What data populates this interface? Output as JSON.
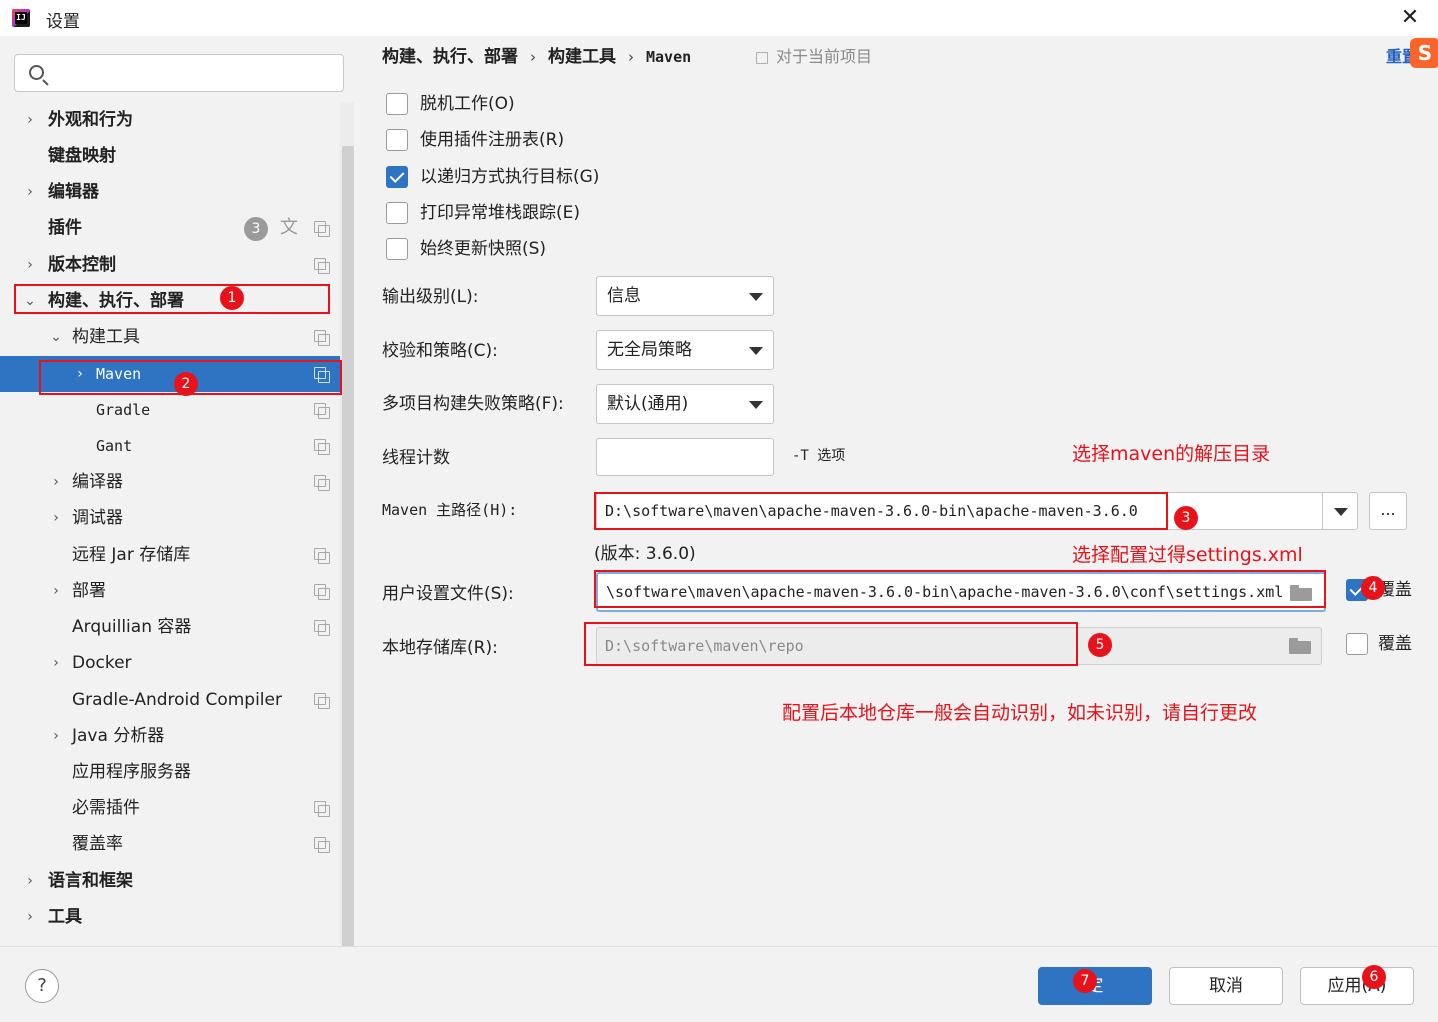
{
  "window": {
    "title": "设置",
    "app_icon": "intellij-idea-icon",
    "close_symbol": "✕"
  },
  "sidebar": {
    "search_placeholder": "",
    "plugins_badge": "3",
    "items": [
      {
        "label": "外观和行为",
        "chevron": "›"
      },
      {
        "label": "键盘映射",
        "chevron": ""
      },
      {
        "label": "编辑器",
        "chevron": "›"
      },
      {
        "label": "插件",
        "chevron": ""
      },
      {
        "label": "版本控制",
        "chevron": "›"
      },
      {
        "label": "构建、执行、部署",
        "chevron": "⌄"
      },
      {
        "label": "构建工具",
        "chevron": "⌄"
      },
      {
        "label": "Maven",
        "chevron": "›"
      },
      {
        "label": "Gradle",
        "chevron": ""
      },
      {
        "label": "Gant",
        "chevron": ""
      },
      {
        "label": "编译器",
        "chevron": "›"
      },
      {
        "label": "调试器",
        "chevron": "›"
      },
      {
        "label": "远程 Jar 存储库",
        "chevron": ""
      },
      {
        "label": "部署",
        "chevron": "›"
      },
      {
        "label": "Arquillian 容器",
        "chevron": ""
      },
      {
        "label": "Docker",
        "chevron": "›"
      },
      {
        "label": "Gradle-Android Compiler",
        "chevron": ""
      },
      {
        "label": "Java 分析器",
        "chevron": "›"
      },
      {
        "label": "应用程序服务器",
        "chevron": ""
      },
      {
        "label": "必需插件",
        "chevron": ""
      },
      {
        "label": "覆盖率",
        "chevron": ""
      },
      {
        "label": "语言和框架",
        "chevron": "›"
      },
      {
        "label": "工具",
        "chevron": "›"
      }
    ]
  },
  "breadcrumb": {
    "part1": "构建、执行、部署",
    "part2": "构建工具",
    "part3": "Maven",
    "sep": "›"
  },
  "scope_label": "对于当前项目",
  "reset_link": "重置",
  "checkboxes": [
    {
      "label": "脱机工作(O)",
      "checked": false
    },
    {
      "label": "使用插件注册表(R)",
      "checked": false
    },
    {
      "label": "以递归方式执行目标(G)",
      "checked": true
    },
    {
      "label": "打印异常堆栈跟踪(E)",
      "checked": false
    },
    {
      "label": "始终更新快照(S)",
      "checked": false
    }
  ],
  "form": {
    "output_level_label": "输出级别(L):",
    "output_level_value": "信息",
    "checksum_label": "校验和策略(C):",
    "checksum_value": "无全局策略",
    "multiproject_label": "多项目构建失败策略(F):",
    "multiproject_value": "默认(通用)",
    "threads_label": "线程计数",
    "threads_value": "",
    "threads_suffix": "-T 选项",
    "maven_home_label": "Maven 主路径(H):",
    "maven_home_value": "D:\\software\\maven\\apache-maven-3.6.0-bin\\apache-maven-3.6.0",
    "maven_home_more": "...",
    "version_text": "(版本: 3.6.0)",
    "user_settings_label": "用户设置文件(S):",
    "user_settings_value": "\\software\\maven\\apache-maven-3.6.0-bin\\apache-maven-3.6.0\\conf\\settings.xml",
    "user_settings_override": "覆盖",
    "local_repo_label": "本地存储库(R):",
    "local_repo_value": "D:\\software\\maven\\repo",
    "local_repo_override": "覆盖"
  },
  "annotations": {
    "hint_maven_dir": "选择maven的解压目录",
    "hint_settings": "选择配置过得settings.xml",
    "hint_local_repo": "配置后本地仓库一般会自动识别，如未识别，请自行更改",
    "markers": [
      "1",
      "2",
      "3",
      "4",
      "5",
      "6",
      "7"
    ]
  },
  "footer": {
    "help": "?",
    "ok_label": "定",
    "cancel_label": "取消",
    "apply_label": "应用(A)"
  },
  "colors": {
    "accent": "#2f73c3",
    "annotation_red": "#e8121b",
    "link_blue": "#2060c0"
  }
}
